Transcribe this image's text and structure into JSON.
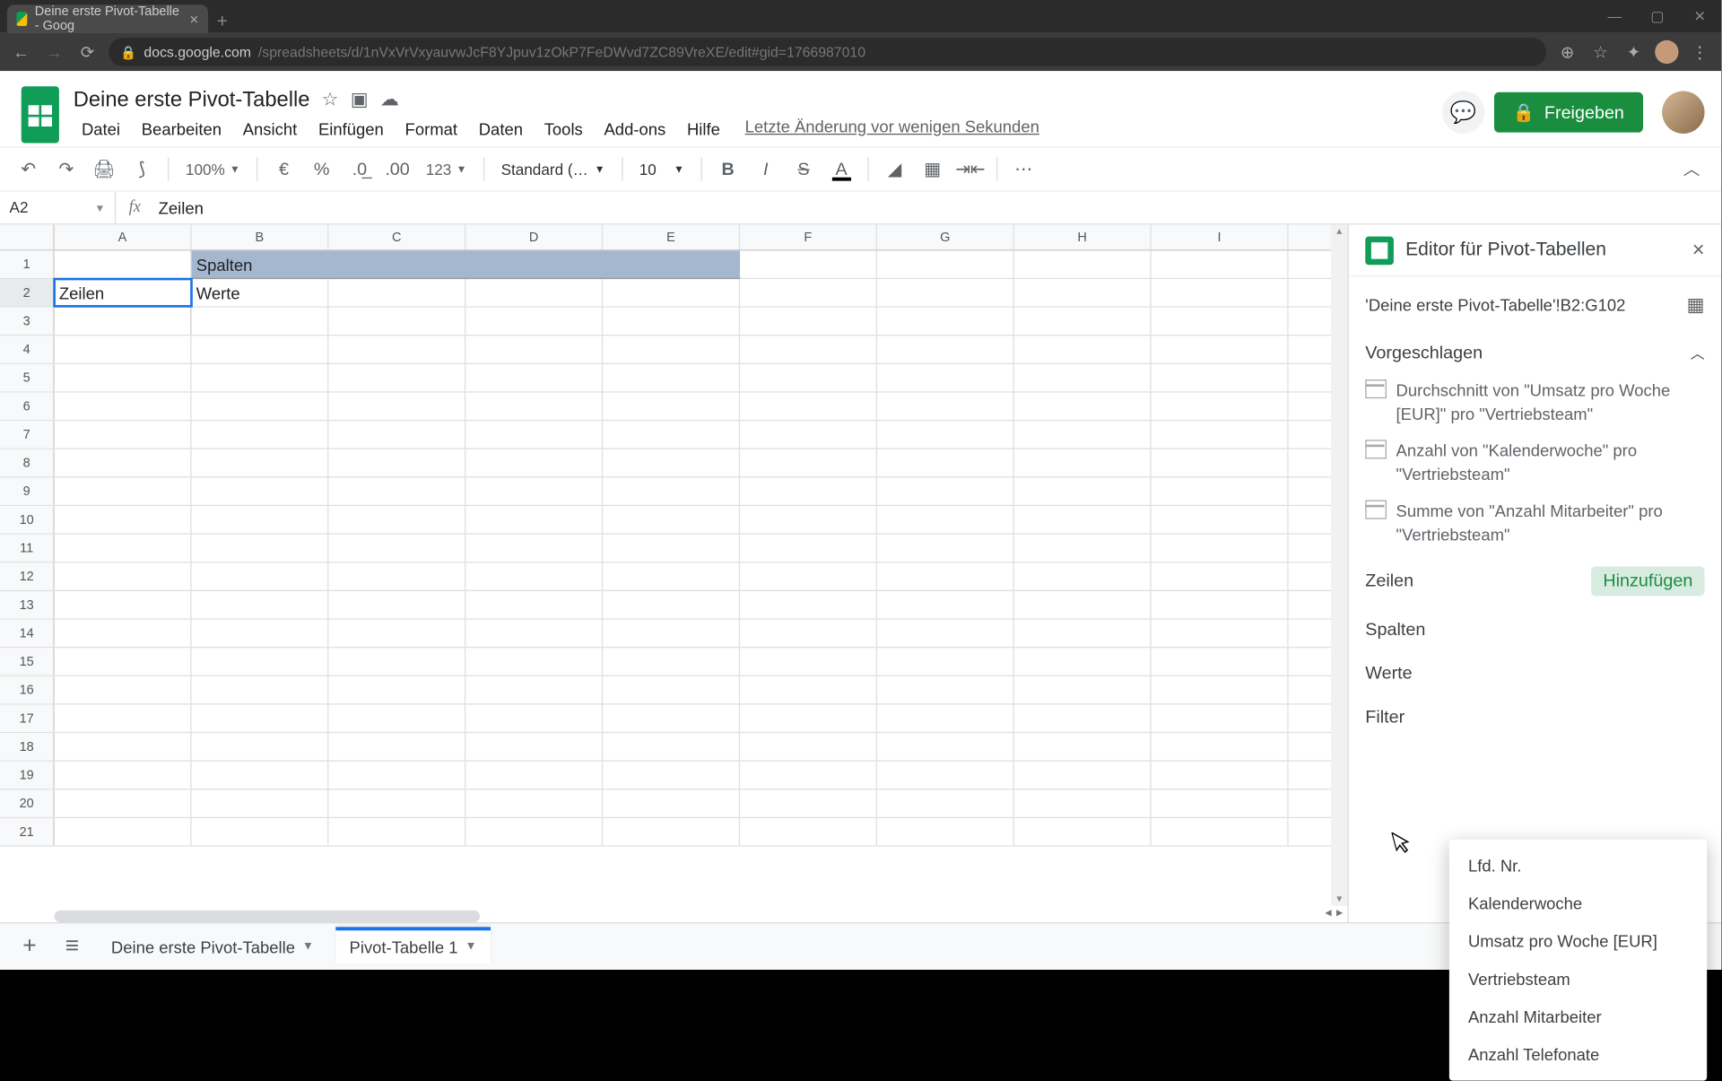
{
  "browser": {
    "tab_title": "Deine erste Pivot-Tabelle - Goog",
    "url_host": "docs.google.com",
    "url_path": "/spreadsheets/d/1nVxVrVxyauvwJcF8YJpuv1zOkP7FeDWvd7ZC89VreXE/edit#gid=1766987010"
  },
  "doc": {
    "title": "Deine erste Pivot-Tabelle",
    "last_edit": "Letzte Änderung vor wenigen Sekunden",
    "share": "Freigeben"
  },
  "menus": [
    "Datei",
    "Bearbeiten",
    "Ansicht",
    "Einfügen",
    "Format",
    "Daten",
    "Tools",
    "Add-ons",
    "Hilfe"
  ],
  "toolbar": {
    "zoom": "100%",
    "font": "Standard (…",
    "size": "10"
  },
  "namebox": "A2",
  "formula": "Zeilen",
  "columns": [
    "A",
    "B",
    "C",
    "D",
    "E",
    "F",
    "G",
    "H",
    "I"
  ],
  "grid": {
    "row1": {
      "b_banner": "Spalten"
    },
    "row2": {
      "a": "Zeilen",
      "b": "Werte"
    }
  },
  "pivot": {
    "title": "Editor für Pivot-Tabellen",
    "range": "'Deine erste Pivot-Tabelle'!B2:G102",
    "suggested_label": "Vorgeschlagen",
    "suggestions": [
      "Durchschnitt von \"Umsatz pro Woche [EUR]\" pro \"Vertriebsteam\"",
      "Anzahl von \"Kalenderwoche\" pro \"Vertriebsteam\"",
      "Summe von \"Anzahl Mitarbeiter\" pro \"Vertriebsteam\""
    ],
    "sections": {
      "rows": "Zeilen",
      "cols": "Spalten",
      "vals": "Werte",
      "filter": "Filter"
    },
    "add": "Hinzufügen",
    "field_options": [
      "Lfd. Nr.",
      "Kalenderwoche",
      "Umsatz pro Woche [EUR]",
      "Vertriebsteam",
      "Anzahl Mitarbeiter",
      "Anzahl Telefonate"
    ]
  },
  "sheets": {
    "tab1": "Deine erste Pivot-Tabelle",
    "tab2": "Pivot-Tabelle 1"
  }
}
